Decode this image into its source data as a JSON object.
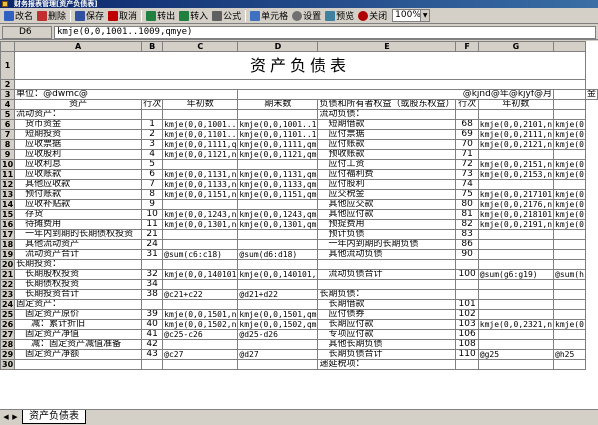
{
  "window": {
    "title": "财务报表管理[资产负债表]"
  },
  "toolbar": {
    "buttons": [
      {
        "id": "rename",
        "label": "改名",
        "icon": "rename-icon"
      },
      {
        "id": "delete",
        "label": "删除",
        "icon": "delete-icon"
      },
      {
        "id": "save",
        "label": "保存",
        "icon": "save-icon"
      },
      {
        "id": "cancel",
        "label": "取消",
        "icon": "cancel-icon"
      },
      {
        "id": "export",
        "label": "转出",
        "icon": "export-icon"
      },
      {
        "id": "import",
        "label": "转入",
        "icon": "import-icon"
      },
      {
        "id": "formula",
        "label": "公式",
        "icon": "formula-icon"
      },
      {
        "id": "cell",
        "label": "单元格",
        "icon": "cell-icon"
      },
      {
        "id": "settings",
        "label": "设置",
        "icon": "gear-icon"
      },
      {
        "id": "preview",
        "label": "预览",
        "icon": "preview-icon"
      },
      {
        "id": "close",
        "label": "关闭",
        "icon": "close-icon"
      }
    ],
    "zoom": "100%"
  },
  "formula_bar": {
    "cell": "D6",
    "formula": "kmje(0,0,1001..1009,qmye)"
  },
  "columns": [
    "A",
    "B",
    "C",
    "D",
    "E",
    "F",
    "G",
    ""
  ],
  "title": "资产负债表",
  "header_row": {
    "unit": "单位：@dwmc@",
    "date": "@kjnd@年@kjyf@月",
    "extra": "金"
  },
  "col_heads": [
    "资产",
    "行次",
    "年初数",
    "期末数",
    "负债和所有者权益（或股东权益）",
    "行次",
    "年初数",
    ""
  ],
  "rows": [
    {
      "n": "5",
      "a": "流动资产：",
      "b": "",
      "c": "",
      "d": "",
      "e": "流动负债：",
      "f": "",
      "g": "",
      "h": ""
    },
    {
      "n": "6",
      "a": "货币资金",
      "ai": 1,
      "b": "1",
      "c": "kmje(0,0,1001..",
      "d": "kmje(0,0,1001..1",
      "e": "短期借款",
      "ei": 1,
      "f": "68",
      "g": "kmje(0,0,2101,n",
      "h": "kmje(0"
    },
    {
      "n": "7",
      "a": "短期投资",
      "ai": 1,
      "b": "2",
      "c": "kmje(0,0,1101..",
      "d": "kmje(0,0,1101..1",
      "e": "应付票据",
      "ei": 1,
      "f": "69",
      "g": "kmje(0,0,2111,n",
      "h": "kmje(0"
    },
    {
      "n": "8",
      "a": "应收票据",
      "ai": 1,
      "b": "3",
      "c": "kmje(0,0,1111,q",
      "d": "kmje(0,0,1111,qm",
      "e": "应付账款",
      "ei": 1,
      "f": "70",
      "g": "kmje(0,0,2121,n",
      "h": "kmje(0"
    },
    {
      "n": "9",
      "a": "应收股利",
      "ai": 1,
      "b": "4",
      "c": "kmje(0,0,1121,n",
      "d": "kmje(0,0,1121,qm",
      "e": "预收账款",
      "ei": 1,
      "f": "71",
      "g": "",
      "h": ""
    },
    {
      "n": "10",
      "a": "应收利息",
      "ai": 1,
      "b": "5",
      "c": "",
      "d": "",
      "e": "应付工资",
      "ei": 1,
      "f": "72",
      "g": "kmje(0,0,2151,n",
      "h": "kmje(0"
    },
    {
      "n": "11",
      "a": "应收账款",
      "ai": 1,
      "b": "6",
      "c": "kmje(0,0,1131,n",
      "d": "kmje(0,0,1131,qm",
      "e": "应付福利费",
      "ei": 1,
      "f": "73",
      "g": "kmje(0,0,2153,n",
      "h": "kmje(0"
    },
    {
      "n": "12",
      "a": "其他应收款",
      "ai": 1,
      "b": "7",
      "c": "kmje(0,0,1133,n",
      "d": "kmje(0,0,1133,qm",
      "e": "应付股利",
      "ei": 1,
      "f": "74",
      "g": "",
      "h": ""
    },
    {
      "n": "13",
      "a": "预付账款",
      "ai": 1,
      "b": "8",
      "c": "kmje(0,0,1151,n",
      "d": "kmje(0,0,1151,qm",
      "e": "应交税金",
      "ei": 1,
      "f": "75",
      "g": "kmje(0,0,217101",
      "h": "kmje(0"
    },
    {
      "n": "14",
      "a": "应收补贴款",
      "ai": 1,
      "b": "9",
      "c": "",
      "d": "",
      "e": "其他应交款",
      "ei": 1,
      "f": "80",
      "g": "kmje(0,0,2176,n",
      "h": "kmje(0"
    },
    {
      "n": "15",
      "a": "存货",
      "ai": 1,
      "b": "10",
      "c": "kmje(0,0,1243,n",
      "d": "kmje(0,0,1243,qm",
      "e": "其他应付款",
      "ei": 1,
      "f": "81",
      "g": "kmje(0,0,218101",
      "h": "kmje(0"
    },
    {
      "n": "16",
      "a": "待摊费用",
      "ai": 1,
      "b": "11",
      "c": "kmje(0,0,1301,n",
      "d": "kmje(0,0,1301,qm",
      "e": "预提费用",
      "ei": 1,
      "f": "82",
      "g": "kmje(0,0,2191,n",
      "h": "kmje(0"
    },
    {
      "n": "17",
      "a": "一年内到期的长期债权投资",
      "ai": 1,
      "b": "21",
      "c": "",
      "d": "",
      "e": "预计负债",
      "ei": 1,
      "f": "83",
      "g": "",
      "h": ""
    },
    {
      "n": "18",
      "a": "其他流动资产",
      "ai": 1,
      "b": "24",
      "c": "",
      "d": "",
      "e": "一年内到期的长期负债",
      "ei": 1,
      "f": "86",
      "g": "",
      "h": ""
    },
    {
      "n": "19",
      "a": "流动资产合计",
      "ai": 1,
      "b": "31",
      "c": "@sum(c6:c18)",
      "d": "@sum(d6:d18)",
      "e": "其他流动负债",
      "ei": 1,
      "f": "90",
      "g": "",
      "h": ""
    },
    {
      "n": "20",
      "a": "长期投资：",
      "b": "",
      "c": "",
      "d": "",
      "e": "",
      "f": "",
      "g": "",
      "h": ""
    },
    {
      "n": "21",
      "a": "长期股权投资",
      "ai": 1,
      "b": "32",
      "c": "kmje(0,0,140101",
      "d": "kmje(0,0,140101,",
      "e": "流动负债合计",
      "ei": 1,
      "f": "100",
      "g": "@sum(g6:g19)",
      "h": "@sum(h"
    },
    {
      "n": "22",
      "a": "长期债权投资",
      "ai": 1,
      "b": "34",
      "c": "",
      "d": "",
      "e": "",
      "f": "",
      "g": "",
      "h": ""
    },
    {
      "n": "23",
      "a": "长期投资合计",
      "ai": 1,
      "b": "38",
      "c": "@c21+c22",
      "d": "@d21+d22",
      "e": "长期负债：",
      "f": "",
      "g": "",
      "h": ""
    },
    {
      "n": "24",
      "a": "固定资产：",
      "b": "",
      "c": "",
      "d": "",
      "e": "长期借款",
      "ei": 1,
      "f": "101",
      "g": "",
      "h": ""
    },
    {
      "n": "25",
      "a": "固定资产原价",
      "ai": 1,
      "b": "39",
      "c": "kmje(0,0,1501,n",
      "d": "kmje(0,0,1501,qm",
      "e": "应付债券",
      "ei": 1,
      "f": "102",
      "g": "",
      "h": ""
    },
    {
      "n": "26",
      "a": "减：累计折旧",
      "ai": 2,
      "b": "40",
      "c": "kmje(0,0,1502,n",
      "d": "kmje(0,0,1502,qm",
      "e": "长期应付款",
      "ei": 1,
      "f": "103",
      "g": "kmje(0,0,2321,n",
      "h": "kmje(0"
    },
    {
      "n": "27",
      "a": "固定资产净值",
      "ai": 1,
      "b": "41",
      "c": "@c25-c26",
      "d": "@d25-d26",
      "e": "专项应付款",
      "ei": 1,
      "f": "106",
      "g": "",
      "h": ""
    },
    {
      "n": "28",
      "a": "减：固定资产减值准备",
      "ai": 2,
      "b": "42",
      "c": "",
      "d": "",
      "e": "其他长期负债",
      "ei": 1,
      "f": "108",
      "g": "",
      "h": ""
    },
    {
      "n": "29",
      "a": "固定资产净额",
      "ai": 1,
      "b": "43",
      "c": "@c27",
      "d": "@d27",
      "e": "长期负债合计",
      "ei": 1,
      "f": "110",
      "g": "@g25",
      "h": "@h25"
    },
    {
      "n": "30",
      "a": "",
      "b": "",
      "c": "",
      "d": "",
      "e": "递延税项：",
      "f": "",
      "g": "",
      "h": ""
    }
  ],
  "sheet_tabs": [
    "资产负债表"
  ]
}
